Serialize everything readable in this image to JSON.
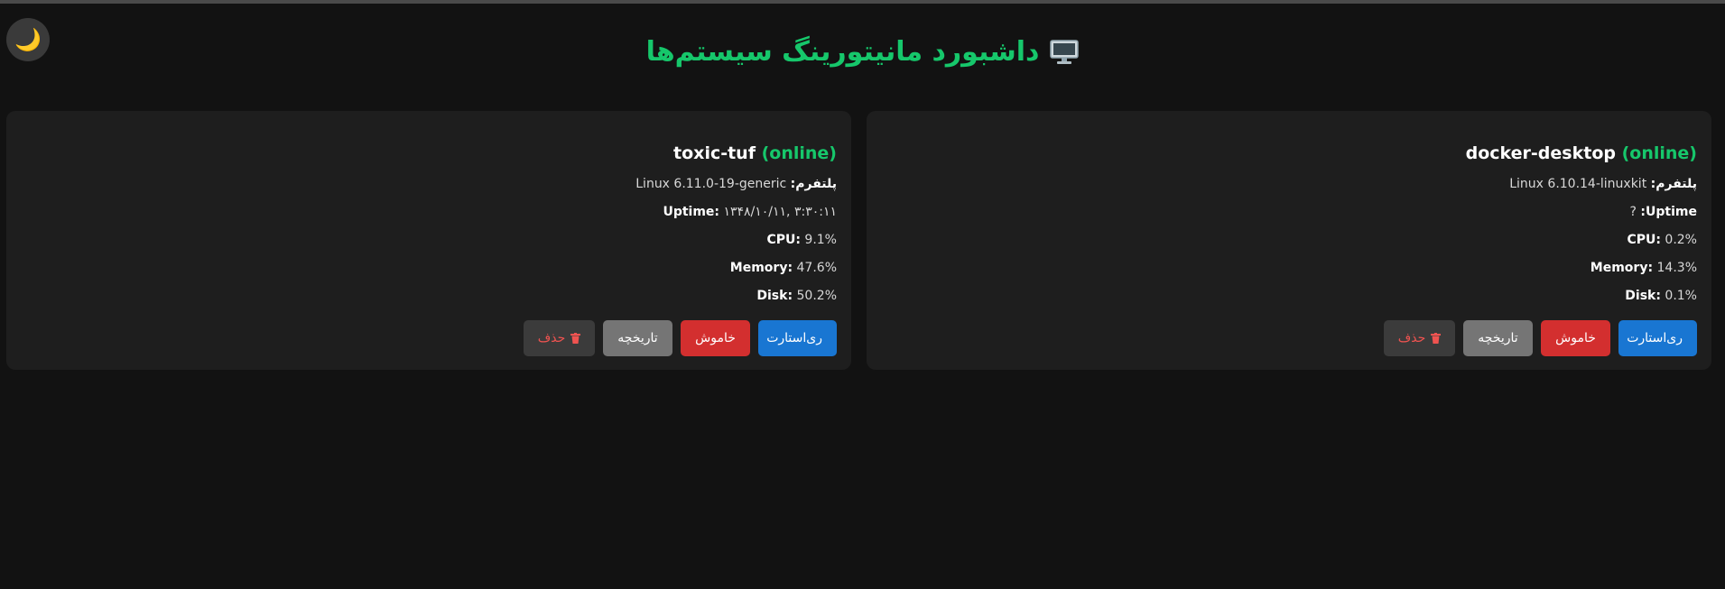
{
  "header": {
    "title": "داشبورد مانیتورینگ سیستم‌ها",
    "icon": "monitor-icon"
  },
  "theme_toggle": {
    "icon": "moon-icon",
    "glyph": "🌙"
  },
  "labels": {
    "platform": "پلتفرم:",
    "uptime": "Uptime:",
    "cpu": "CPU:",
    "memory": "Memory:",
    "disk": "Disk:"
  },
  "hosts": [
    {
      "name": "docker-desktop",
      "status": "(online)",
      "platform": "Linux 6.10.14-linuxkit",
      "uptime": "?",
      "cpu": "0.2%",
      "memory": "14.3%",
      "disk": "0.1%",
      "buttons": {
        "restart": "ری‌استارت",
        "shutdown": "خاموش",
        "history": "تاریخچه",
        "delete": "حذف"
      }
    },
    {
      "name": "toxic-tuf",
      "status": "(online)",
      "platform": "Linux 6.11.0-19-generic",
      "uptime": "۱۳۴۸/۱۰/۱۱, ۳:۳۰:۱۱",
      "cpu": "9.1%",
      "memory": "47.6%",
      "disk": "50.2%",
      "buttons": {
        "restart": "ری‌استارت",
        "shutdown": "خاموش",
        "history": "تاریخچه",
        "delete": "حذف"
      }
    }
  ],
  "colors": {
    "accent": "#16c76b",
    "background": "#121212",
    "card": "#1e1e1e",
    "restart": "#1976d2",
    "shutdown": "#d32f2f",
    "history": "#757575",
    "delete_text": "#ef5350"
  }
}
